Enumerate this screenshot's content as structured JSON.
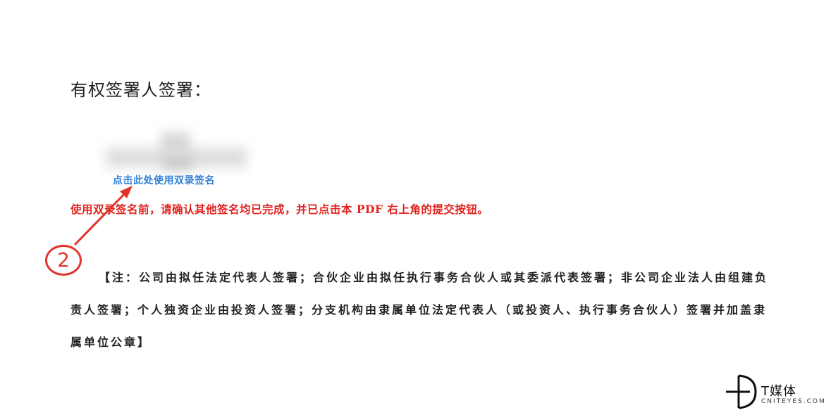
{
  "document": {
    "heading": "有权签署人签署：",
    "sign_link": "点击此处使用双录签名",
    "warning": "使用双录签名前，请确认其他签名均已完成，并已点击本 PDF 右上角的提交按钮。",
    "callout_number": "2",
    "note": "【注：公司由拟任法定代表人签署；合伙企业由拟任执行事务合伙人或其委派代表签署；非公司企业法人由组建负责人签署；个人独资企业由投资人签署；分支机构由隶属单位法定代表人（或投资人、执行事务合伙人）签署并加盖隶属单位公章】"
  },
  "watermark": {
    "name": "T媒体",
    "sub": "CNITEYES.COM"
  },
  "colors": {
    "link": "#2f80d8",
    "warning": "#e0231f",
    "callout": "#e1342b"
  }
}
